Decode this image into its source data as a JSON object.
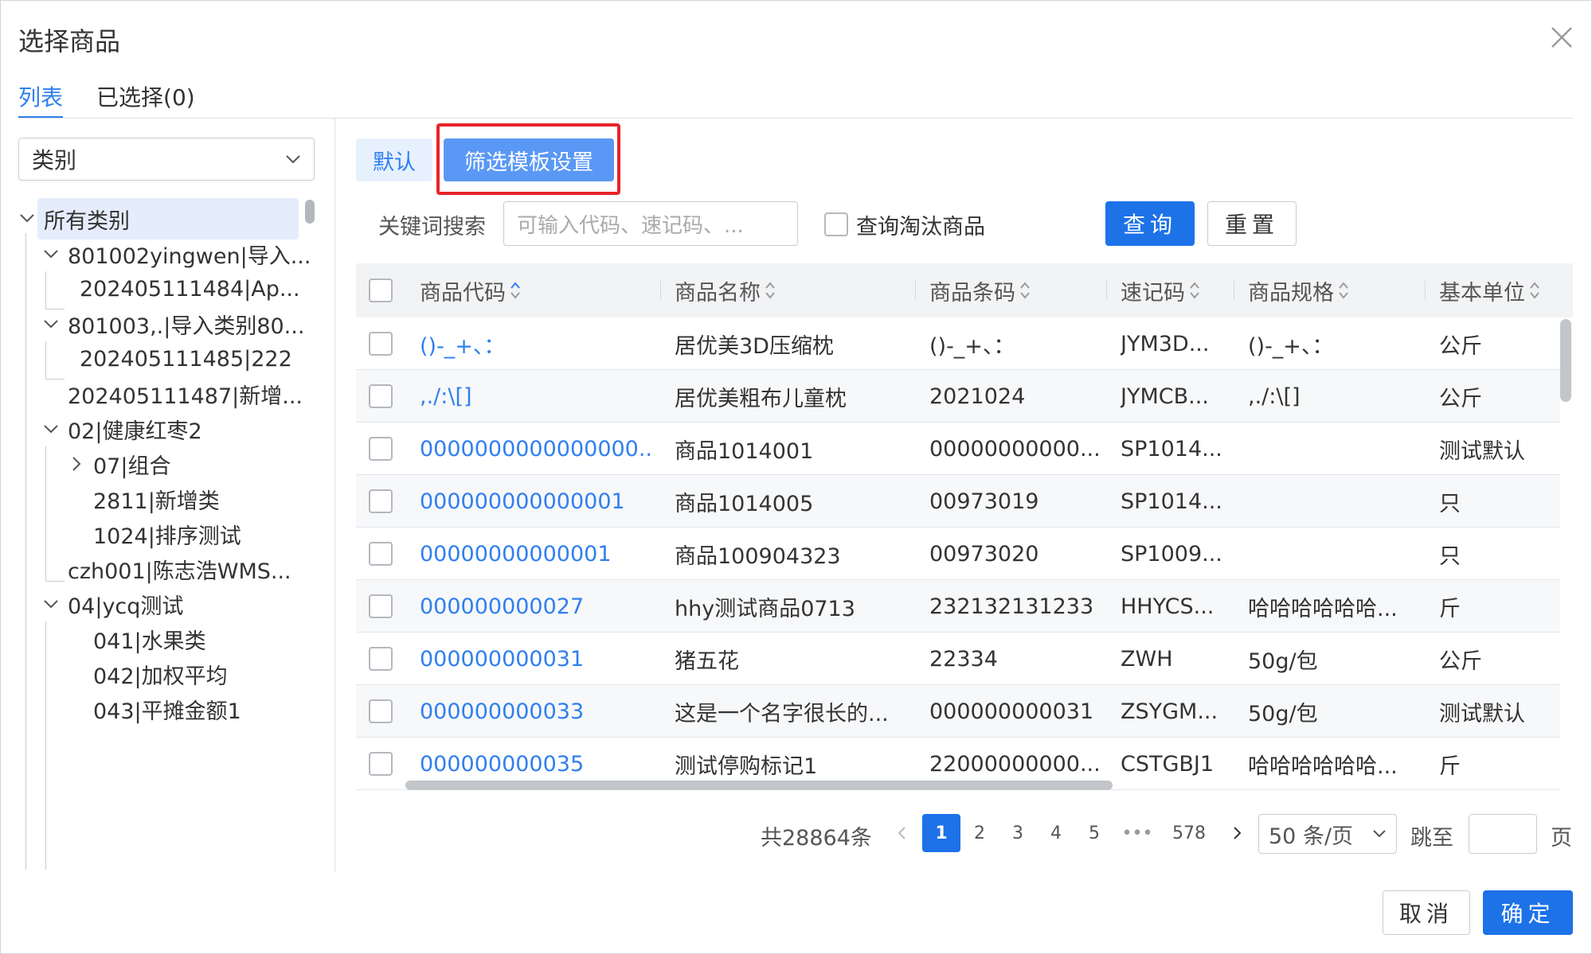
{
  "dialog": {
    "title": "选择商品"
  },
  "tabs": [
    {
      "label": "列表",
      "active": true
    },
    {
      "label": "已选择(0)",
      "active": false
    }
  ],
  "category_select": {
    "value": "类别"
  },
  "tree": [
    {
      "label": "所有类别",
      "selected": true,
      "expanded": true
    },
    {
      "label": "801002yingwen|导入...",
      "expanded": true
    },
    {
      "label": "202405111484|Ap..."
    },
    {
      "label": "801003,.|导入类别80...",
      "expanded": true
    },
    {
      "label": "202405111485|222"
    },
    {
      "label": "202405111487|新增..."
    },
    {
      "label": "02|健康红枣2",
      "expanded": true
    },
    {
      "label": "07|组合",
      "expanded": false
    },
    {
      "label": "2811|新增类"
    },
    {
      "label": "1024|排序测试"
    },
    {
      "label": "czh001|陈志浩WMS..."
    },
    {
      "label": "04|ycq测试",
      "expanded": true
    },
    {
      "label": "041|水果类"
    },
    {
      "label": "042|加权平均"
    },
    {
      "label": "043|平摊金额1"
    }
  ],
  "toolbar": {
    "default_label": "默认",
    "filter_template_label": "筛选模板设置"
  },
  "search": {
    "keyword_label": "关键词搜索",
    "placeholder": "可输入代码、速记码、...",
    "obsolete_label": "查询淘汰商品",
    "query_label": "查询",
    "reset_label": "重置"
  },
  "table": {
    "columns": [
      "商品代码",
      "商品名称",
      "商品条码",
      "速记码",
      "商品规格",
      "基本单位"
    ],
    "rows": [
      [
        "()-_+、：",
        "居优美3D压缩枕",
        "()-_+、：",
        "JYM3D...",
        "()-_+、：",
        "公斤"
      ],
      [
        ",./:\\[]",
        "居优美粗布儿童枕",
        "2021024",
        "JYMCB...",
        ",./:\\[]",
        "公斤"
      ],
      [
        "0000000000000000...",
        "商品1014001",
        "00000000000...",
        "SP1014...",
        "",
        "测试默认"
      ],
      [
        "000000000000001",
        "商品1014005",
        "00973019",
        "SP1014...",
        "",
        "只"
      ],
      [
        "00000000000001",
        "商品100904323",
        "00973020",
        "SP1009...",
        "",
        "只"
      ],
      [
        "000000000027",
        "hhy测试商品0713",
        "232132131233",
        "HHYCS...",
        "哈哈哈哈哈哈...",
        "斤"
      ],
      [
        "000000000031",
        "猪五花",
        "22334",
        "ZWH",
        "50g/包",
        "公斤"
      ],
      [
        "000000000033",
        "这是一个名字很长的...",
        "000000000031",
        "ZSYGM...",
        "50g/包",
        "测试默认"
      ],
      [
        "000000000035",
        "测试停购标记1",
        "22000000000...",
        "CSTGBJ1",
        "哈哈哈哈哈哈...",
        "斤"
      ]
    ]
  },
  "pagination": {
    "total": "共28864条",
    "pages": [
      "1",
      "2",
      "3",
      "4",
      "5",
      "•••",
      "578"
    ],
    "current": "1",
    "page_size": "50 条/页",
    "jump_label": "跳至",
    "page_suffix": "页"
  },
  "footer": {
    "cancel_label": "取消",
    "ok_label": "确定"
  },
  "colors": {
    "primary": "#1d72e8",
    "link": "#2f7fef",
    "highlight_border": "#e8232a"
  }
}
